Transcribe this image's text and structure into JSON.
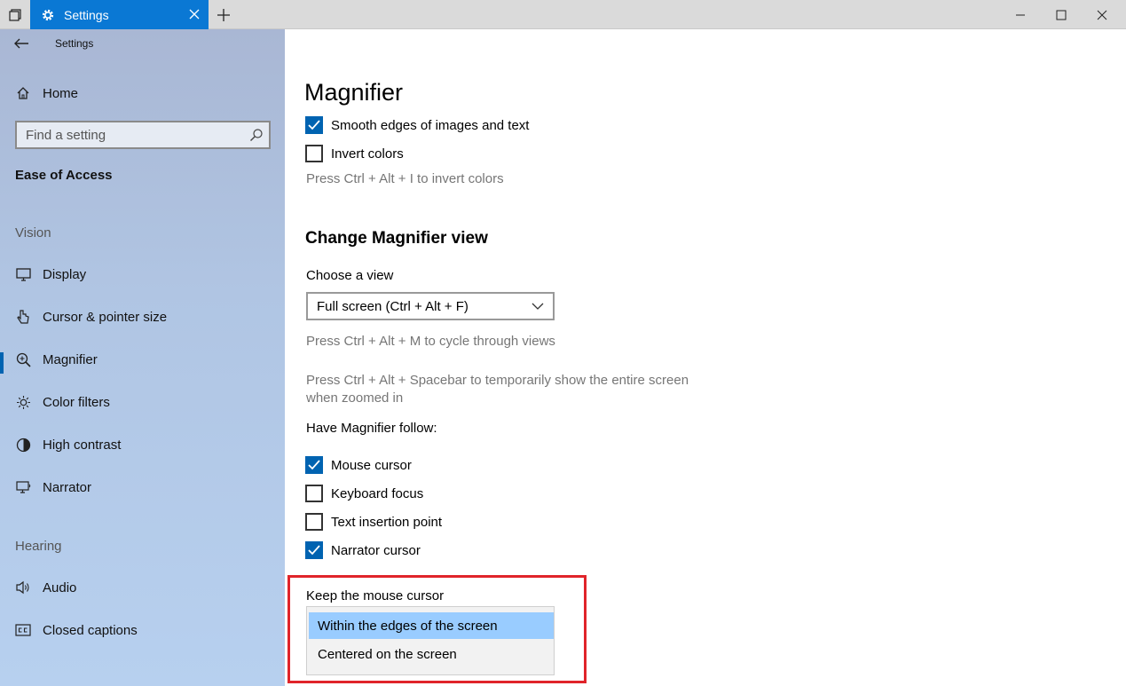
{
  "window": {
    "tab_title": "Settings",
    "colors": {
      "accent": "#0a78d4",
      "check": "#0063b1",
      "highlight_box": "#e0242a",
      "selected_option": "#99ccff"
    }
  },
  "sidebar": {
    "app_title": "Settings",
    "home_label": "Home",
    "search_placeholder": "Find a setting",
    "section_title": "Ease of Access",
    "groups": [
      {
        "title": "Vision",
        "items": [
          {
            "label": "Display",
            "icon": "monitor-icon"
          },
          {
            "label": "Cursor & pointer size",
            "icon": "pointer-icon"
          },
          {
            "label": "Magnifier",
            "icon": "magnifier-icon",
            "selected": true
          },
          {
            "label": "Color filters",
            "icon": "sun-icon"
          },
          {
            "label": "High contrast",
            "icon": "contrast-icon"
          },
          {
            "label": "Narrator",
            "icon": "narrator-icon"
          }
        ]
      },
      {
        "title": "Hearing",
        "items": [
          {
            "label": "Audio",
            "icon": "speaker-icon"
          },
          {
            "label": "Closed captions",
            "icon": "cc-icon"
          }
        ]
      }
    ]
  },
  "main": {
    "title": "Magnifier",
    "smooth_edges": {
      "label": "Smooth edges of images and text",
      "checked": true
    },
    "invert_colors": {
      "label": "Invert colors",
      "checked": false
    },
    "invert_hint": "Press Ctrl + Alt + I to invert colors",
    "view_heading": "Change Magnifier view",
    "choose_view_label": "Choose a view",
    "choose_view_value": "Full screen (Ctrl + Alt + F)",
    "cycle_hint": "Press Ctrl + Alt + M to cycle through views",
    "spacebar_hint_1": "Press Ctrl + Alt + Spacebar to temporarily show the entire screen",
    "spacebar_hint_2": "when zoomed in",
    "follow_label": "Have Magnifier follow:",
    "follow": [
      {
        "label": "Mouse cursor",
        "checked": true
      },
      {
        "label": "Keyboard focus",
        "checked": false
      },
      {
        "label": "Text insertion point",
        "checked": false
      },
      {
        "label": "Narrator cursor",
        "checked": true
      }
    ],
    "keep_cursor_label": "Keep the mouse cursor",
    "keep_cursor_options": [
      {
        "label": "Within the edges of the screen",
        "selected": true
      },
      {
        "label": "Centered on the screen",
        "selected": false
      }
    ]
  }
}
